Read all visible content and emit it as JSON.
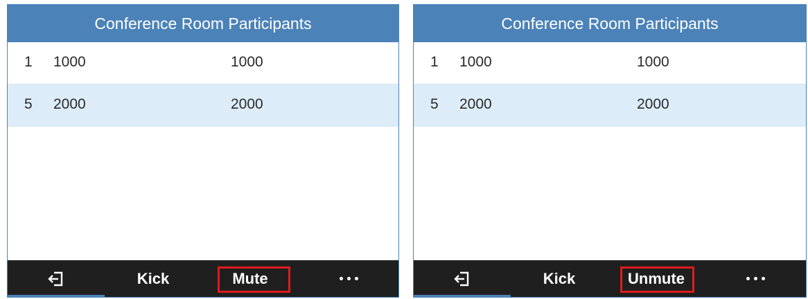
{
  "panels": [
    {
      "title": "Conference Room Participants",
      "rows": [
        {
          "index": "1",
          "number": "1000",
          "name": "1000"
        },
        {
          "index": "5",
          "number": "2000",
          "name": "2000"
        }
      ],
      "softkeys": {
        "exit_icon": "exit-icon",
        "kick": "Kick",
        "action": "Mute",
        "more_icon": "more-dots-icon"
      },
      "highlighted_softkey": "Mute"
    },
    {
      "title": "Conference Room Participants",
      "rows": [
        {
          "index": "1",
          "number": "1000",
          "name": "1000"
        },
        {
          "index": "5",
          "number": "2000",
          "name": "2000"
        }
      ],
      "softkeys": {
        "exit_icon": "exit-icon",
        "kick": "Kick",
        "action": "Unmute",
        "more_icon": "more-dots-icon"
      },
      "highlighted_softkey": "Unmute"
    }
  ],
  "colors": {
    "header_bg": "#4b82b8",
    "selected_row_bg": "#dcecf9",
    "softkey_bar_bg": "#1f1f1f",
    "highlight_box": "#e01b1b"
  }
}
